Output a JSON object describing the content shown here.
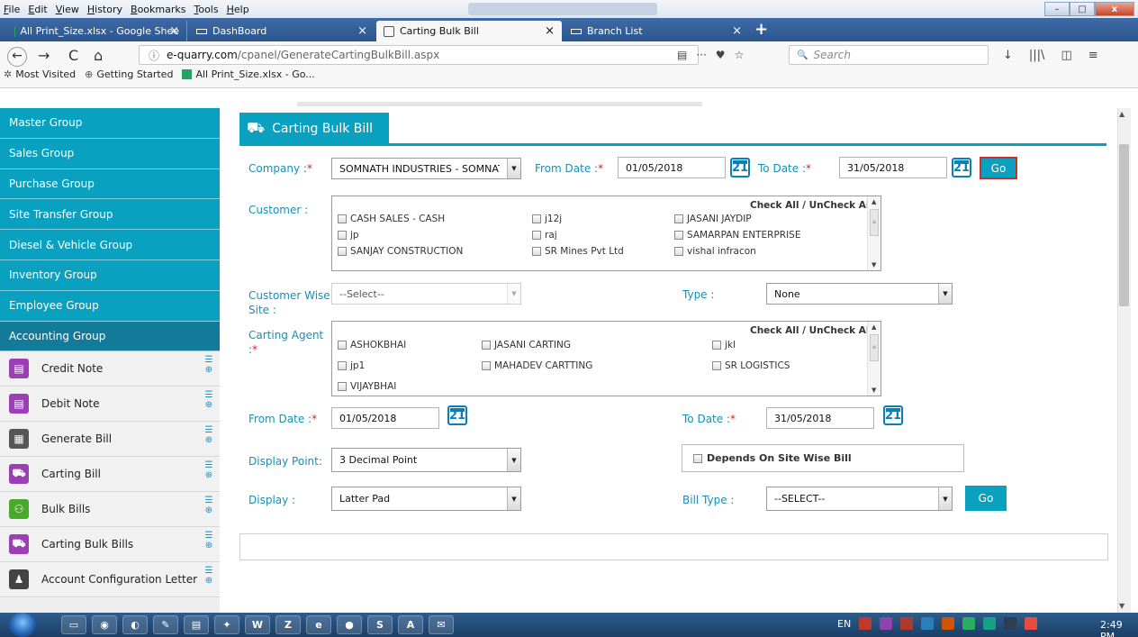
{
  "menu": [
    "File",
    "Edit",
    "View",
    "History",
    "Bookmarks",
    "Tools",
    "Help"
  ],
  "window_buttons": {
    "minimize": "–",
    "maximize": "□",
    "close": "x"
  },
  "tabs": [
    {
      "label": "All Print_Size.xlsx - Google Shee",
      "icon": "sheets-icon"
    },
    {
      "label": "DashBoard",
      "icon": "page-icon"
    },
    {
      "label": "Carting Bulk Bill",
      "icon": "cart-icon"
    },
    {
      "label": "Branch List",
      "icon": "page-icon"
    }
  ],
  "tab_close": "×",
  "new_tab": "+",
  "nav": {
    "back": "←",
    "forward": "→",
    "reload": "C",
    "home": "⌂",
    "url_domain": "e-quarry.com",
    "url_path": "/cpanel/GenerateCartingBulkBill.aspx",
    "url_info": "ⓘ",
    "url_tools": [
      "▤",
      "···",
      "♥",
      "☆"
    ],
    "search_placeholder": "Search",
    "search_icon": "🔍",
    "right_tools": [
      "↓",
      "|||\\",
      "◫",
      "≡"
    ]
  },
  "bookmarks": [
    {
      "label": "Most Visited",
      "icon": "gear-icon"
    },
    {
      "label": "Getting Started",
      "icon": "firefox-icon"
    },
    {
      "label": "All Print_Size.xlsx - Go...",
      "icon": "sheets-icon"
    }
  ],
  "sidebar": {
    "groups": [
      "Master Group",
      "Sales Group",
      "Purchase Group",
      "Site Transfer Group",
      "Diesel & Vehicle Group",
      "Inventory Group",
      "Employee Group",
      "Accounting Group"
    ],
    "items": [
      {
        "label": "Credit Note",
        "color": "#9b3fb5"
      },
      {
        "label": "Debit Note",
        "color": "#9b3fb5"
      },
      {
        "label": "Generate Bill",
        "color": "#555555"
      },
      {
        "label": "Carting Bill",
        "color": "#9b3fb5"
      },
      {
        "label": "Bulk Bills",
        "color": "#4aa82a"
      },
      {
        "label": "Carting Bulk Bills",
        "color": "#9b3fb5"
      },
      {
        "label": "Account Configuration Letter",
        "color": "#444444"
      }
    ]
  },
  "page": {
    "title": "Carting Bulk Bill",
    "company_label": "Company :",
    "required": "*",
    "company_value": "SOMNATH INDUSTRIES - SOMNAT",
    "from_date_label": "From Date :",
    "from_date": "01/05/2018",
    "to_date_label": "To Date :",
    "to_date": "31/05/2018",
    "go": "Go",
    "cal_day": "21",
    "customer_label": "Customer :",
    "check_all": "Check All / UnCheck All",
    "customers": [
      "CASH SALES - CASH",
      "j12j",
      "JASANI JAYDIP",
      "jp",
      "raj",
      "SAMARPAN ENTERPRISE",
      "SANJAY CONSTRUCTION",
      "SR Mines Pvt Ltd",
      "vishal infracon"
    ],
    "customer_site_label": "Customer Wise Site :",
    "customer_site_value": "--Select--",
    "type_label": "Type :",
    "type_value": "None",
    "agent_label": "Carting Agent :",
    "agents": [
      "ASHOKBHAI",
      "JASANI CARTING",
      "jkl",
      "jp1",
      "MAHADEV CARTTING",
      "SR LOGISTICS",
      "VIJAYBHAI"
    ],
    "from_date2_label": "From Date :",
    "from_date2": "01/05/2018",
    "to_date2_label": "To Date :",
    "to_date2": "31/05/2018",
    "display_point_label": "Display Point:",
    "display_point_value": "3 Decimal Point",
    "depends_label": "Depends On Site Wise Bill",
    "display_label": "Display :",
    "display_value": "Latter Pad",
    "bill_type_label": "Bill Type :",
    "bill_type_value": "--SELECT--",
    "go2": "Go"
  },
  "taskbar": {
    "lang": "EN",
    "clock": "2:49 PM"
  }
}
